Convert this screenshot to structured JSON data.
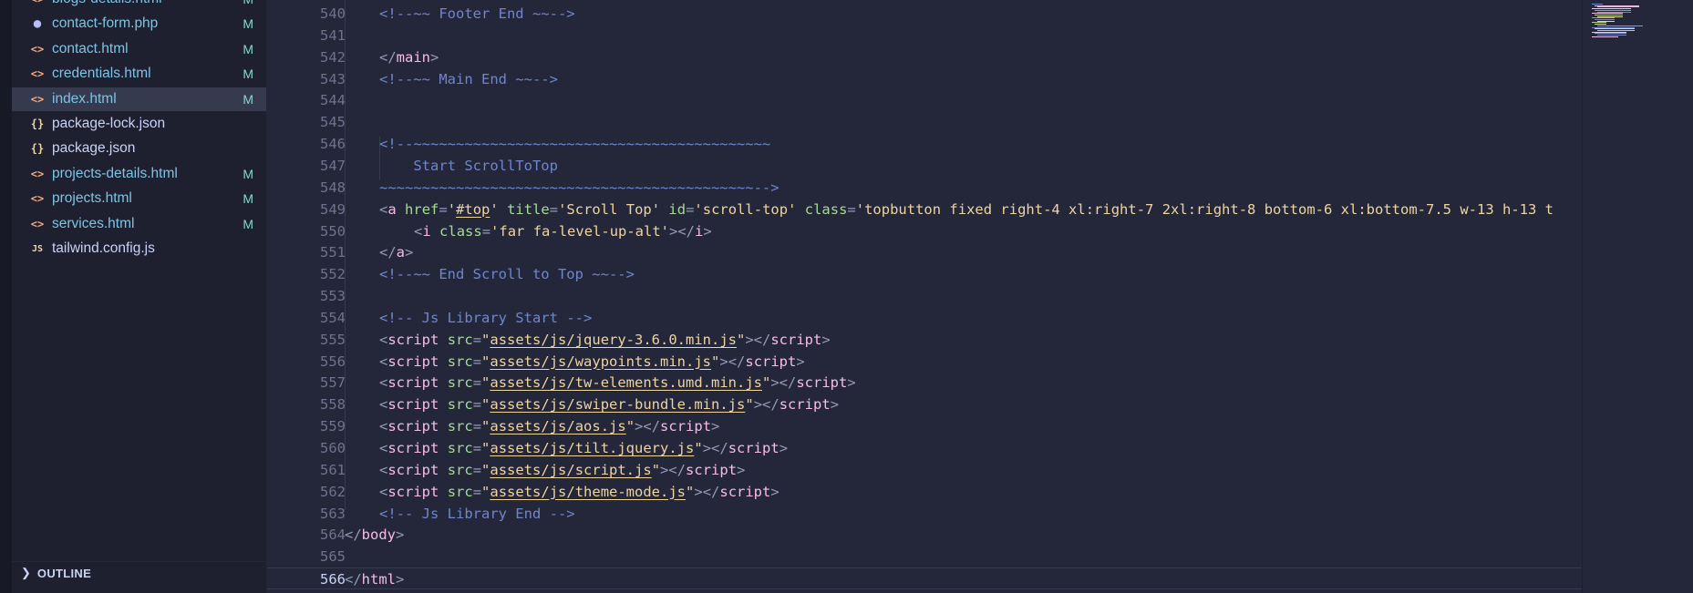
{
  "explorer": {
    "files": [
      {
        "name": "blogs-details.html",
        "icon": "html-icon",
        "status": "M",
        "modified": true
      },
      {
        "name": "contact-form.php",
        "icon": "php-icon",
        "status": "M",
        "modified": true
      },
      {
        "name": "contact.html",
        "icon": "html-icon",
        "status": "M",
        "modified": true
      },
      {
        "name": "credentials.html",
        "icon": "html-icon",
        "status": "M",
        "modified": true
      },
      {
        "name": "index.html",
        "icon": "html-icon",
        "status": "M",
        "modified": true,
        "selected": true
      },
      {
        "name": "package-lock.json",
        "icon": "json-icon",
        "status": "",
        "modified": false
      },
      {
        "name": "package.json",
        "icon": "json-icon",
        "status": "",
        "modified": false
      },
      {
        "name": "projects-details.html",
        "icon": "html-icon",
        "status": "M",
        "modified": true
      },
      {
        "name": "projects.html",
        "icon": "html-icon",
        "status": "M",
        "modified": true
      },
      {
        "name": "services.html",
        "icon": "html-icon",
        "status": "M",
        "modified": true
      },
      {
        "name": "tailwind.config.js",
        "icon": "js-icon",
        "status": "",
        "modified": false
      }
    ],
    "outline_label": "OUTLINE"
  },
  "editor": {
    "current_line": 566,
    "lines": [
      {
        "n": "540",
        "indent": 1,
        "tokens": [
          [
            "cm",
            "<!--~~ Footer End ~~-->"
          ]
        ]
      },
      {
        "n": "541",
        "indent": 0,
        "tokens": []
      },
      {
        "n": "542",
        "indent": 1,
        "tokens": [
          [
            "p",
            "</"
          ],
          [
            "tag",
            "main"
          ],
          [
            "p",
            ">"
          ]
        ]
      },
      {
        "n": "543",
        "indent": 1,
        "tokens": [
          [
            "cm",
            "<!--~~ Main End ~~-->"
          ]
        ]
      },
      {
        "n": "544",
        "indent": 0,
        "tokens": []
      },
      {
        "n": "545",
        "indent": 0,
        "tokens": []
      },
      {
        "n": "546",
        "indent": 1,
        "tokens": [
          [
            "cm",
            "<!--~~~~~~~~~~~~~~~~~~~~~~~~~~~~~~~~~~~~~~~~~~"
          ]
        ]
      },
      {
        "n": "547",
        "indent": 1,
        "tokens": [
          [
            "cm",
            "    Start ScrollToTop"
          ]
        ]
      },
      {
        "n": "548",
        "indent": 1,
        "tokens": [
          [
            "cm",
            "~~~~~~~~~~~~~~~~~~~~~~~~~~~~~~~~~~~~~~~~~~~~-->"
          ]
        ]
      },
      {
        "n": "549",
        "indent": 1,
        "tokens": [
          [
            "p",
            "<"
          ],
          [
            "tag",
            "a"
          ],
          [
            "txt",
            " "
          ],
          [
            "attr",
            "href"
          ],
          [
            "p",
            "="
          ],
          [
            "str",
            "'"
          ],
          [
            "ustr",
            "#top"
          ],
          [
            "str",
            "'"
          ],
          [
            "txt",
            " "
          ],
          [
            "attr",
            "title"
          ],
          [
            "p",
            "="
          ],
          [
            "str",
            "'Scroll Top'"
          ],
          [
            "txt",
            " "
          ],
          [
            "attr",
            "id"
          ],
          [
            "p",
            "="
          ],
          [
            "str",
            "'scroll-top'"
          ],
          [
            "txt",
            " "
          ],
          [
            "attr",
            "class"
          ],
          [
            "p",
            "="
          ],
          [
            "str",
            "'topbutton fixed right-4 xl:right-7 2xl:right-8 bottom-6 xl:bottom-7.5 w-13 h-13 t"
          ]
        ]
      },
      {
        "n": "550",
        "indent": 2,
        "tokens": [
          [
            "p",
            "<"
          ],
          [
            "tag",
            "i"
          ],
          [
            "txt",
            " "
          ],
          [
            "attr",
            "class"
          ],
          [
            "p",
            "="
          ],
          [
            "str",
            "'far fa-level-up-alt'"
          ],
          [
            "p",
            "></"
          ],
          [
            "tag",
            "i"
          ],
          [
            "p",
            ">"
          ]
        ]
      },
      {
        "n": "551",
        "indent": 1,
        "tokens": [
          [
            "p",
            "</"
          ],
          [
            "tag",
            "a"
          ],
          [
            "p",
            ">"
          ]
        ]
      },
      {
        "n": "552",
        "indent": 1,
        "tokens": [
          [
            "cm",
            "<!--~~ End Scroll to Top ~~-->"
          ]
        ]
      },
      {
        "n": "553",
        "indent": 0,
        "tokens": []
      },
      {
        "n": "554",
        "indent": 1,
        "tokens": [
          [
            "cm",
            "<!-- Js Library Start -->"
          ]
        ]
      },
      {
        "n": "555",
        "indent": 1,
        "tokens": [
          [
            "p",
            "<"
          ],
          [
            "tag",
            "script"
          ],
          [
            "txt",
            " "
          ],
          [
            "attr",
            "src"
          ],
          [
            "p",
            "="
          ],
          [
            "str",
            "\""
          ],
          [
            "ustr",
            "assets/js/jquery-3.6.0.min.js"
          ],
          [
            "str",
            "\""
          ],
          [
            "p",
            "></"
          ],
          [
            "tag",
            "script"
          ],
          [
            "p",
            ">"
          ]
        ]
      },
      {
        "n": "556",
        "indent": 1,
        "tokens": [
          [
            "p",
            "<"
          ],
          [
            "tag",
            "script"
          ],
          [
            "txt",
            " "
          ],
          [
            "attr",
            "src"
          ],
          [
            "p",
            "="
          ],
          [
            "str",
            "\""
          ],
          [
            "ustr",
            "assets/js/waypoints.min.js"
          ],
          [
            "str",
            "\""
          ],
          [
            "p",
            "></"
          ],
          [
            "tag",
            "script"
          ],
          [
            "p",
            ">"
          ]
        ]
      },
      {
        "n": "557",
        "indent": 1,
        "tokens": [
          [
            "p",
            "<"
          ],
          [
            "tag",
            "script"
          ],
          [
            "txt",
            " "
          ],
          [
            "attr",
            "src"
          ],
          [
            "p",
            "="
          ],
          [
            "str",
            "\""
          ],
          [
            "ustr",
            "assets/js/tw-elements.umd.min.js"
          ],
          [
            "str",
            "\""
          ],
          [
            "p",
            "></"
          ],
          [
            "tag",
            "script"
          ],
          [
            "p",
            ">"
          ]
        ]
      },
      {
        "n": "558",
        "indent": 1,
        "tokens": [
          [
            "p",
            "<"
          ],
          [
            "tag",
            "script"
          ],
          [
            "txt",
            " "
          ],
          [
            "attr",
            "src"
          ],
          [
            "p",
            "="
          ],
          [
            "str",
            "\""
          ],
          [
            "ustr",
            "assets/js/swiper-bundle.min.js"
          ],
          [
            "str",
            "\""
          ],
          [
            "p",
            "></"
          ],
          [
            "tag",
            "script"
          ],
          [
            "p",
            ">"
          ]
        ]
      },
      {
        "n": "559",
        "indent": 1,
        "tokens": [
          [
            "p",
            "<"
          ],
          [
            "tag",
            "script"
          ],
          [
            "txt",
            " "
          ],
          [
            "attr",
            "src"
          ],
          [
            "p",
            "="
          ],
          [
            "str",
            "\""
          ],
          [
            "ustr",
            "assets/js/aos.js"
          ],
          [
            "str",
            "\""
          ],
          [
            "p",
            "></"
          ],
          [
            "tag",
            "script"
          ],
          [
            "p",
            ">"
          ]
        ]
      },
      {
        "n": "560",
        "indent": 1,
        "tokens": [
          [
            "p",
            "<"
          ],
          [
            "tag",
            "script"
          ],
          [
            "txt",
            " "
          ],
          [
            "attr",
            "src"
          ],
          [
            "p",
            "="
          ],
          [
            "str",
            "\""
          ],
          [
            "ustr",
            "assets/js/tilt.jquery.js"
          ],
          [
            "str",
            "\""
          ],
          [
            "p",
            "></"
          ],
          [
            "tag",
            "script"
          ],
          [
            "p",
            ">"
          ]
        ]
      },
      {
        "n": "561",
        "indent": 1,
        "tokens": [
          [
            "p",
            "<"
          ],
          [
            "tag",
            "script"
          ],
          [
            "txt",
            " "
          ],
          [
            "attr",
            "src"
          ],
          [
            "p",
            "="
          ],
          [
            "str",
            "\""
          ],
          [
            "ustr",
            "assets/js/script.js"
          ],
          [
            "str",
            "\""
          ],
          [
            "p",
            "></"
          ],
          [
            "tag",
            "script"
          ],
          [
            "p",
            ">"
          ]
        ]
      },
      {
        "n": "562",
        "indent": 1,
        "tokens": [
          [
            "p",
            "<"
          ],
          [
            "tag",
            "script"
          ],
          [
            "txt",
            " "
          ],
          [
            "attr",
            "src"
          ],
          [
            "p",
            "="
          ],
          [
            "str",
            "\""
          ],
          [
            "ustr",
            "assets/js/theme-mode.js"
          ],
          [
            "str",
            "\""
          ],
          [
            "p",
            "></"
          ],
          [
            "tag",
            "script"
          ],
          [
            "p",
            ">"
          ]
        ]
      },
      {
        "n": "563",
        "indent": 1,
        "tokens": [
          [
            "cm",
            "<!-- Js Library End -->"
          ]
        ]
      },
      {
        "n": "564",
        "indent": 0,
        "tokens": [
          [
            "p",
            "</"
          ],
          [
            "tag",
            "body"
          ],
          [
            "p",
            ">"
          ]
        ]
      },
      {
        "n": "565",
        "indent": 0,
        "tokens": []
      },
      {
        "n": "566",
        "indent": 0,
        "tokens": [
          [
            "p",
            "</"
          ],
          [
            "tag",
            "html"
          ],
          [
            "p",
            ">"
          ]
        ]
      }
    ]
  }
}
